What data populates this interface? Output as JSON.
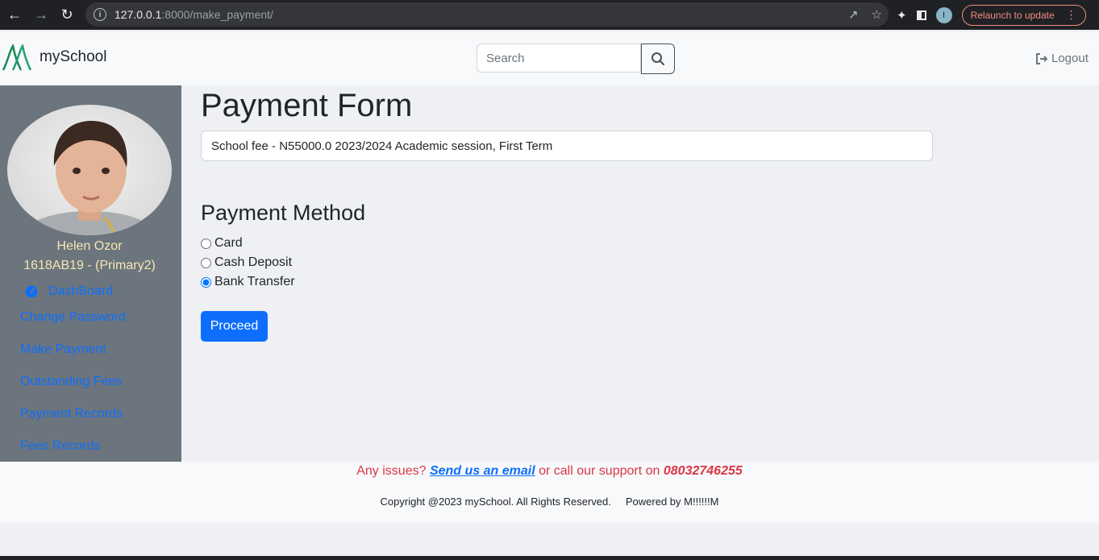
{
  "browser": {
    "url_host": "127.0.0.1",
    "url_path": ":8000/make_payment/",
    "profile_initial": "I",
    "relaunch_label": "Relaunch to update"
  },
  "navbar": {
    "brand": "mySchool",
    "search_placeholder": "Search",
    "logout_label": "Logout"
  },
  "sidebar": {
    "student_name": "Helen Ozor",
    "student_id": "1618AB19 - (Primary2)",
    "links": {
      "dashboard": "DashBoard",
      "change_password": "Change Password",
      "make_payment": "Make Payment",
      "outstanding_fees": "Outstanding Fees",
      "payment_records": "Payment Records",
      "fees_records": "Fees Records"
    }
  },
  "main": {
    "title": "Payment Form",
    "fee_value": "School fee - N55000.0 2023/2024 Academic session, First Term",
    "method_title": "Payment Method",
    "methods": {
      "card": "Card",
      "cash": "Cash Deposit",
      "bank": "Bank Transfer"
    },
    "selected_method": "Bank Transfer",
    "proceed_label": "Proceed"
  },
  "footer": {
    "issues_prefix": "Any issues?",
    "email_link": "Send us an email",
    "issues_middle": "or call our support on",
    "phone": "08032746255",
    "copyright": "Copyright @2023 mySchool. All Rights Reserved.",
    "powered_by": "Powered by M!!!!!!M"
  },
  "colors": {
    "primary": "#0d6efd",
    "sidebar_bg": "#6c757d",
    "accent_text": "#f6e7b4",
    "danger": "#dc3545"
  }
}
